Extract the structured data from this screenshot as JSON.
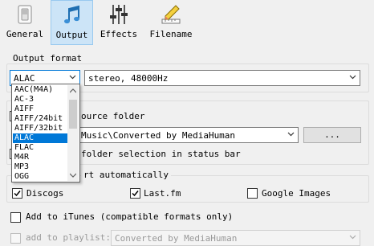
{
  "toolbar": {
    "items": [
      {
        "label": "General",
        "icon": "switch-icon",
        "active": false
      },
      {
        "label": "Output",
        "icon": "music-note-icon",
        "active": true
      },
      {
        "label": "Effects",
        "icon": "equalizer-sliders-icon",
        "active": false
      },
      {
        "label": "Filename",
        "icon": "pencil-ruler-icon",
        "active": false
      }
    ]
  },
  "output_format": {
    "group_label": "Output format",
    "format_value": "ALAC",
    "quality_value": "stereo, 48000Hz",
    "options": [
      "AAC(M4A)",
      "AC-3",
      "AIFF",
      "AIFF/24bit",
      "AIFF/32bit",
      "ALAC",
      "FLAC",
      "M4R",
      "MP3",
      "OGG"
    ],
    "selected_option": "ALAC"
  },
  "folder": {
    "source_label": "ource folder",
    "path_value": "Music\\Converted by MediaHuman",
    "browse_label": "...",
    "status_bar_label": "folder selection in status bar"
  },
  "start": {
    "group_label": "rt automatically",
    "discogs": "Discogs",
    "lastfm": "Last.fm",
    "google": "Google Images"
  },
  "itunes": {
    "add_label": "Add to iTunes (compatible formats only)",
    "playlist_label": "add to playlist:",
    "playlist_value": "Converted by MediaHuman"
  },
  "colors": {
    "accent": "#0078d7",
    "active_tab": "#cce4f7"
  }
}
